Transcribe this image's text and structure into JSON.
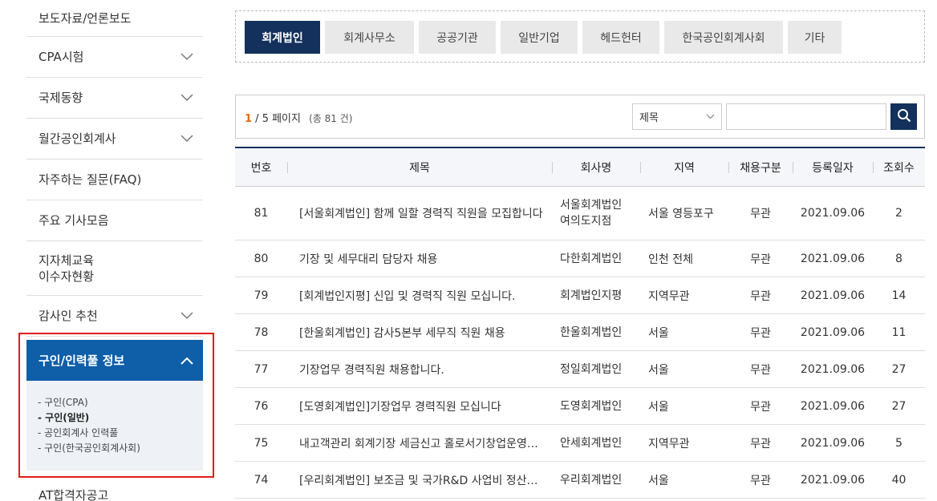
{
  "sidebar": {
    "items": [
      {
        "label": "보도자료/언론보도",
        "chevron": false
      },
      {
        "label": "CPA시험",
        "chevron": true
      },
      {
        "label": "국제동향",
        "chevron": true
      },
      {
        "label": "월간공인회계사",
        "chevron": true
      },
      {
        "label": "자주하는 질문(FAQ)",
        "chevron": false
      },
      {
        "label": "주요 기사모음",
        "chevron": false
      },
      {
        "label": "지자체교육\n이수자현황",
        "chevron": false
      },
      {
        "label": "감사인 추천",
        "chevron": true
      }
    ],
    "active": {
      "label": "구인/인력풀 정보",
      "sub_items": [
        {
          "label": "- 구인(CPA)"
        },
        {
          "label": "- 구인(일반)"
        },
        {
          "label": "- 공인회계사 인력풀"
        },
        {
          "label": "- 구인(한국공인회계사회)"
        }
      ]
    },
    "last_item": "AT합격자공고"
  },
  "tabs": [
    {
      "label": "회계법인"
    },
    {
      "label": "회계사무소"
    },
    {
      "label": "공공기관"
    },
    {
      "label": "일반기업"
    },
    {
      "label": "헤드헌터"
    },
    {
      "label": "한국공인회계사회"
    },
    {
      "label": "기타"
    }
  ],
  "search": {
    "current_page": "1",
    "page_rest": " / 5 페이지",
    "total": "(총 81 건)",
    "select_value": "제목",
    "input_value": ""
  },
  "table": {
    "headers": [
      "번호",
      "제목",
      "회사명",
      "지역",
      "채용구분",
      "등록일자",
      "조회수"
    ],
    "rows": [
      {
        "no": "81",
        "title": "[서울회계법인] 함께 일할 경력직 직원을 모집합니다",
        "company": "서울회계법인\n여의도지점",
        "region": "서울   영등포구",
        "type": "무관",
        "date": "2021.09.06",
        "views": "2"
      },
      {
        "no": "80",
        "title": "기장 및 세무대리 담당자 채용",
        "company": "다한회계법인",
        "region": "인천   전체",
        "type": "무관",
        "date": "2021.09.06",
        "views": "8"
      },
      {
        "no": "79",
        "title": "[회계법인지평] 신입 및 경력직 직원 모십니다.",
        "company": "회계법인지평",
        "region": "지역무관",
        "type": "무관",
        "date": "2021.09.06",
        "views": "14"
      },
      {
        "no": "78",
        "title": "[한울회계법인] 감사5본부 세무직 직원 채용",
        "company": "한울회계법인",
        "region": "서울",
        "type": "무관",
        "date": "2021.09.06",
        "views": "11"
      },
      {
        "no": "77",
        "title": "기장업무 경력직원 채용합니다.",
        "company": "정일회계법인",
        "region": "서울",
        "type": "무관",
        "date": "2021.09.06",
        "views": "27"
      },
      {
        "no": "76",
        "title": "[도영회계법인]기장업무 경력직원 모십니다",
        "company": "도영회계법인",
        "region": "서울",
        "type": "무관",
        "date": "2021.09.06",
        "views": "27"
      },
      {
        "no": "75",
        "title": "내고객관리 회계기장 세금신고 홀로서기창업운영…",
        "company": "안세회계법인",
        "region": "지역무관",
        "type": "무관",
        "date": "2021.09.06",
        "views": "5"
      },
      {
        "no": "74",
        "title": "[우리회계법인] 보조금 및 국가R&D 사업비 정산…",
        "company": "우리회계법인",
        "region": "서울",
        "type": "무관",
        "date": "2021.09.06",
        "views": "40"
      }
    ]
  }
}
